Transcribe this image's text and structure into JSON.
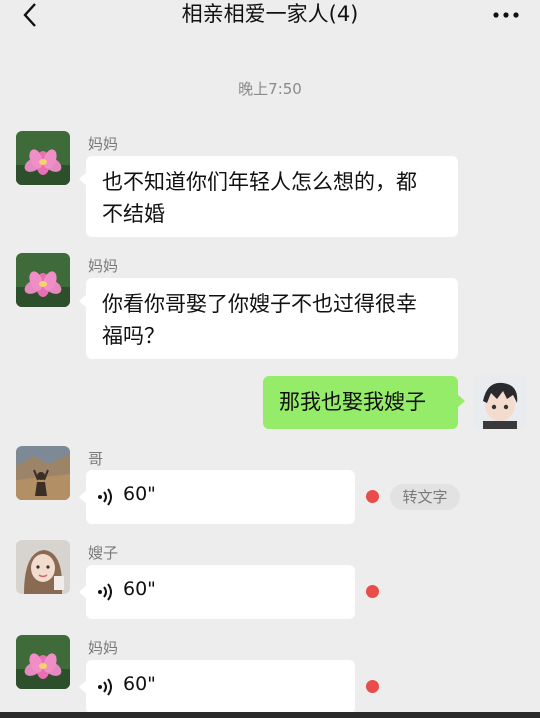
{
  "header": {
    "title": "相亲相爱一家人(4)",
    "back_icon": "chevron-left-icon",
    "more_icon": "more-dots-icon"
  },
  "timestamp": "晚上7:50",
  "messages": [
    {
      "sender": "妈妈",
      "text": "也不知道你们年轻人怎么想的，都不结婚",
      "lines": [
        "也不知道你们年轻人怎么想的，都",
        "不结婚"
      ],
      "avatar": "lotus-avatar"
    },
    {
      "sender": "妈妈",
      "text": "你看你哥娶了你嫂子不也过得很幸福吗？",
      "lines": [
        "你看你哥娶了你嫂子不也过得很幸",
        "福吗？"
      ],
      "avatar": "lotus-avatar"
    },
    {
      "sender": "me",
      "text": "那我也娶我嫂子",
      "avatar": "anime-boy-avatar"
    },
    {
      "sender": "哥",
      "duration": "60\"",
      "type": "voice",
      "convert_label": "转文字",
      "avatar": "desert-avatar"
    },
    {
      "sender": "嫂子",
      "duration": "60\"",
      "type": "voice",
      "avatar": "girl-avatar"
    },
    {
      "sender": "妈妈",
      "duration": "60\"",
      "type": "voice",
      "avatar": "lotus-avatar"
    }
  ],
  "colors": {
    "background": "#ededed",
    "my_bubble": "#95ec69",
    "other_bubble": "#ffffff",
    "unread_dot": "#e94d4a"
  }
}
